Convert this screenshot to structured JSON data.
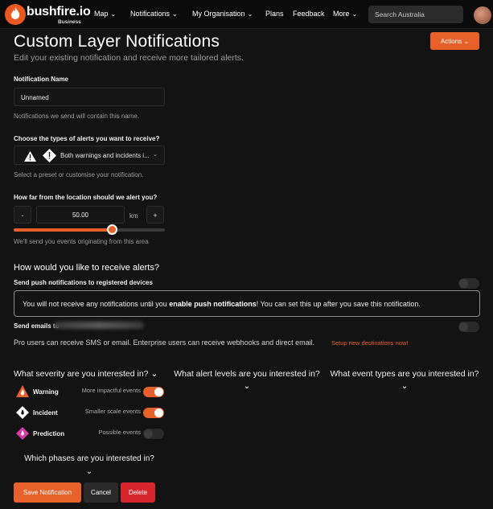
{
  "nav": {
    "brand": "bushfire.io",
    "brand_sub": "Business",
    "items": [
      {
        "label": "Map",
        "has_chevron": true
      },
      {
        "label": "Notifications",
        "has_chevron": true
      },
      {
        "label": "My Organisation",
        "has_chevron": true
      },
      {
        "label": "Plans",
        "has_chevron": false
      },
      {
        "label": "Feedback",
        "has_chevron": false
      },
      {
        "label": "More",
        "has_chevron": true
      }
    ],
    "search_placeholder": "Search Australia"
  },
  "page": {
    "title": "Custom Layer Notifications",
    "subtitle": "Edit your existing notification and receive more tailored alerts.",
    "actions_label": "Actions"
  },
  "name_field": {
    "label": "Notification Name",
    "value": "Unnamed",
    "hint": "Notifications we send will contain this name."
  },
  "alert_types": {
    "label": "Choose the types of alerts you want to receive?",
    "selected": "Both warnings and incidents i...",
    "hint": "Select a preset or customise your notification."
  },
  "distance": {
    "label": "How far from the location should we alert you?",
    "minus": "-",
    "value": "50.00",
    "unit": "km",
    "plus": "+",
    "slider_fraction": 0.65,
    "hint": "We'll send you events originating from this area"
  },
  "receive": {
    "heading": "How would you like to receive alerts?",
    "push_label": "Send push notifications to registered devices",
    "push_on": false,
    "notice_pre": "You will not receive any notifications until you ",
    "notice_bold": "enable push notifications",
    "notice_post": "! You can set this up after you save this notification.",
    "email_label": "Send emails to",
    "email_on": false,
    "pro_text": "Pro users can receive SMS or email. Enterprise users can receive webhooks and direct email.",
    "setup_link": "Setup new destinations now!"
  },
  "severity": {
    "heading": "What severity are you interested in?",
    "rows": [
      {
        "name": "Warning",
        "desc": "More impactful events",
        "on": true,
        "color": "#e8612a"
      },
      {
        "name": "Incident",
        "desc": "Smaller scale events",
        "on": true,
        "color": "#ffffff"
      },
      {
        "name": "Prediction",
        "desc": "Possible events",
        "on": false,
        "color": "#d63aa8"
      }
    ]
  },
  "alert_levels": {
    "heading": "What alert levels are you interested in?"
  },
  "event_types": {
    "heading": "What event types are you interested in?"
  },
  "phases": {
    "heading": "Which phases are you interested in?"
  },
  "buttons": {
    "save": "Save Notification",
    "cancel": "Cancel",
    "delete": "Delete"
  },
  "colors": {
    "accent": "#e8612a",
    "danger": "#d9262e",
    "background": "#131313"
  }
}
